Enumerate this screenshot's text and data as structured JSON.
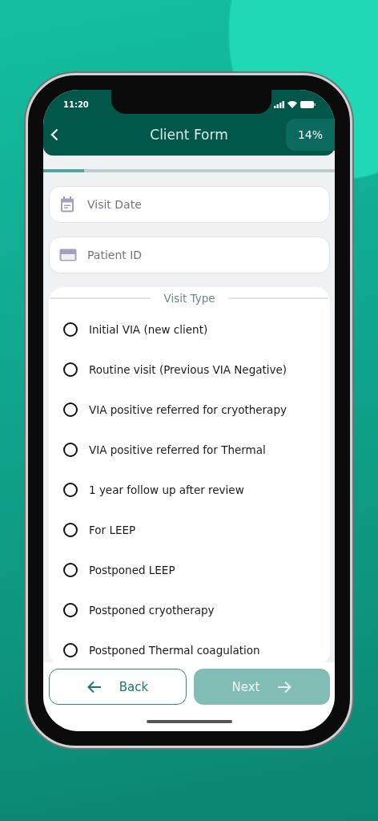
{
  "status_bar": {
    "time": "11:20"
  },
  "header": {
    "title": "Client Form",
    "progress_label": "14%"
  },
  "progress": {
    "level": 0.14
  },
  "fields": [
    {
      "kind": "date",
      "placeholder": "Visit Date"
    },
    {
      "kind": "card",
      "placeholder": "Patient ID"
    }
  ],
  "visit_type": {
    "heading": "Visit Type",
    "options": [
      {
        "label": "Initial VIA (new client)",
        "selected": false
      },
      {
        "label": "Routine visit (Previous VIA Negative)",
        "selected": false
      },
      {
        "label": "VIA positive referred for cryotherapy",
        "selected": false
      },
      {
        "label": "VIA positive referred for Thermal",
        "selected": false
      },
      {
        "label": "1 year follow up after review",
        "selected": false
      },
      {
        "label": "For LEEP",
        "selected": false
      },
      {
        "label": "Postponed LEEP",
        "selected": false
      },
      {
        "label": "Postponed cryotherapy",
        "selected": false
      },
      {
        "label": "Postponed Thermal coagulation",
        "selected": false
      }
    ]
  },
  "buttons": [
    {
      "kind": "back",
      "label": "Back",
      "disabled": false
    },
    {
      "kind": "next",
      "label": "Next",
      "disabled": true
    }
  ]
}
